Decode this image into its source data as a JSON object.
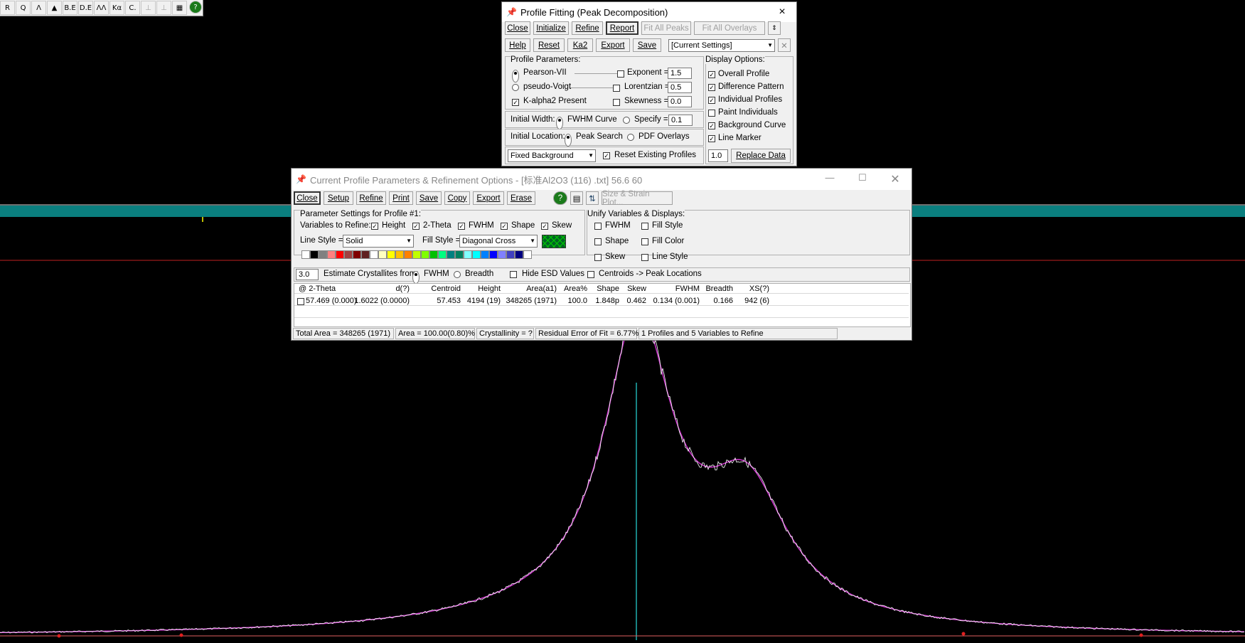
{
  "toolbar": {
    "icons": [
      "cursor-icon",
      "magnifier-icon",
      "peak-icon",
      "histogram-icon",
      "be-icon",
      "de-icon",
      "multi-peak-icon",
      "ka2-icon",
      "c-icon",
      "disabled-bars-icon",
      "disabled-bars2-icon",
      "grid-icon",
      "help-icon"
    ],
    "labels": [
      "R",
      "Q",
      "Λ",
      "▲",
      "B.E",
      "D.E",
      "ΛΛ",
      "Kα",
      "C.",
      "⊥",
      "⊥",
      "▦",
      "?"
    ]
  },
  "profile_fitting": {
    "title": "Profile Fitting (Peak Decomposition)",
    "close": "×",
    "buttons_row1": [
      "Close",
      "Initialize",
      "Refine",
      "Report",
      "Fit All Peaks",
      "Fit All Overlays"
    ],
    "buttons_row2": [
      "Help",
      "Reset",
      "Ka2",
      "Export",
      "Save"
    ],
    "settings_select": "[Current Settings]",
    "profile_params_label": "Profile Parameters:",
    "pearson": "Pearson-VII",
    "pseudo": "pseudo-Voigt",
    "kalpha": "K-alpha2 Present",
    "exponent_label": "Exponent =",
    "exponent": "1.5",
    "lorentzian_label": "Lorentzian =",
    "lorentzian": "0.5",
    "skewness_label": "Skewness =",
    "skewness": "0.0",
    "initial_width": "Initial Width:",
    "fwhm_curve": "FWHM Curve",
    "specify": "Specify =",
    "specify_val": "0.1",
    "initial_location": "Initial Location:",
    "peak_search": "Peak Search",
    "pdf_overlays": "PDF Overlays",
    "background_select": "Fixed Background",
    "reset_profiles": "Reset Existing Profiles",
    "display_options": "Display Options:",
    "display": [
      "Overall Profile",
      "Difference Pattern",
      "Individual Profiles",
      "Paint Individuals",
      "Background Curve",
      "Line Marker"
    ],
    "display_checked": [
      true,
      true,
      true,
      false,
      true,
      true
    ],
    "replace_val": "1.0",
    "replace_btn": "Replace Data"
  },
  "current_params": {
    "title": "Current Profile Parameters & Refinement Options - [标准Al2O3  (116)  .txt] 56.6      60",
    "buttons": [
      "Close",
      "Setup",
      "Refine",
      "Print",
      "Save",
      "Copy",
      "Export",
      "Erase"
    ],
    "size_strain": "Size & Strain Plot...",
    "param_settings": "Parameter Settings for Profile #1:",
    "vars_label": "Variables to Refine:",
    "vars": [
      "Height",
      "2-Theta",
      "FWHM",
      "Shape",
      "Skew"
    ],
    "line_style_label": "Line Style =",
    "line_style": "Solid",
    "fill_style_label": "Fill Style =",
    "fill_style": "Diagonal Cross",
    "unify_label": "Unify Variables & Displays:",
    "unify": [
      "FWHM",
      "Fill Style",
      "Shape",
      "Fill Color",
      "Skew",
      "Line Style"
    ],
    "crystallites_val": "3.0",
    "crystallites_label": "Estimate Crystallites from:",
    "fwhm": "FWHM",
    "breadth": "Breadth",
    "hide_esd": "Hide ESD Values",
    "centroids": "Centroids -> Peak Locations",
    "columns": [
      "@ 2-Theta",
      "d(?)",
      "Centroid",
      "Height",
      "Area(a1)",
      "Area%",
      "Shape",
      "Skew",
      "FWHM",
      "Breadth",
      "XS(?)"
    ],
    "row": [
      "57.469 (0.000)",
      "1.6022 (0.0000)",
      "57.453",
      "4194 (19)",
      "348265 (1971)",
      "100.0",
      "1.848p",
      "0.462",
      "0.134 (0.001)",
      "0.166",
      "942 (6)"
    ],
    "status": [
      "Total Area = 348265 (1971)",
      "Area = 100.00(0.80)%",
      "Crystallinity = ?",
      "Residual Error of Fit = 6.77%",
      "1 Profiles and 5 Variables to Refine"
    ],
    "colors": [
      "#ffffff",
      "#000000",
      "#808080",
      "#ff8080",
      "#ff0000",
      "#a04040",
      "#800000",
      "#602020",
      "#ffffff",
      "#ffffc0",
      "#ffff00",
      "#ffc000",
      "#ff8000",
      "#c0ff00",
      "#80ff00",
      "#00c000",
      "#00ff80",
      "#008080",
      "#008060",
      "#80ffff",
      "#00ffff",
      "#0080ff",
      "#0000ff",
      "#8080ff",
      "#4040c0",
      "#000080",
      "#ffffff"
    ]
  },
  "colors": {
    "teal": "#0a8a8a",
    "magenta": "#cc33cc",
    "red": "#e02020"
  }
}
